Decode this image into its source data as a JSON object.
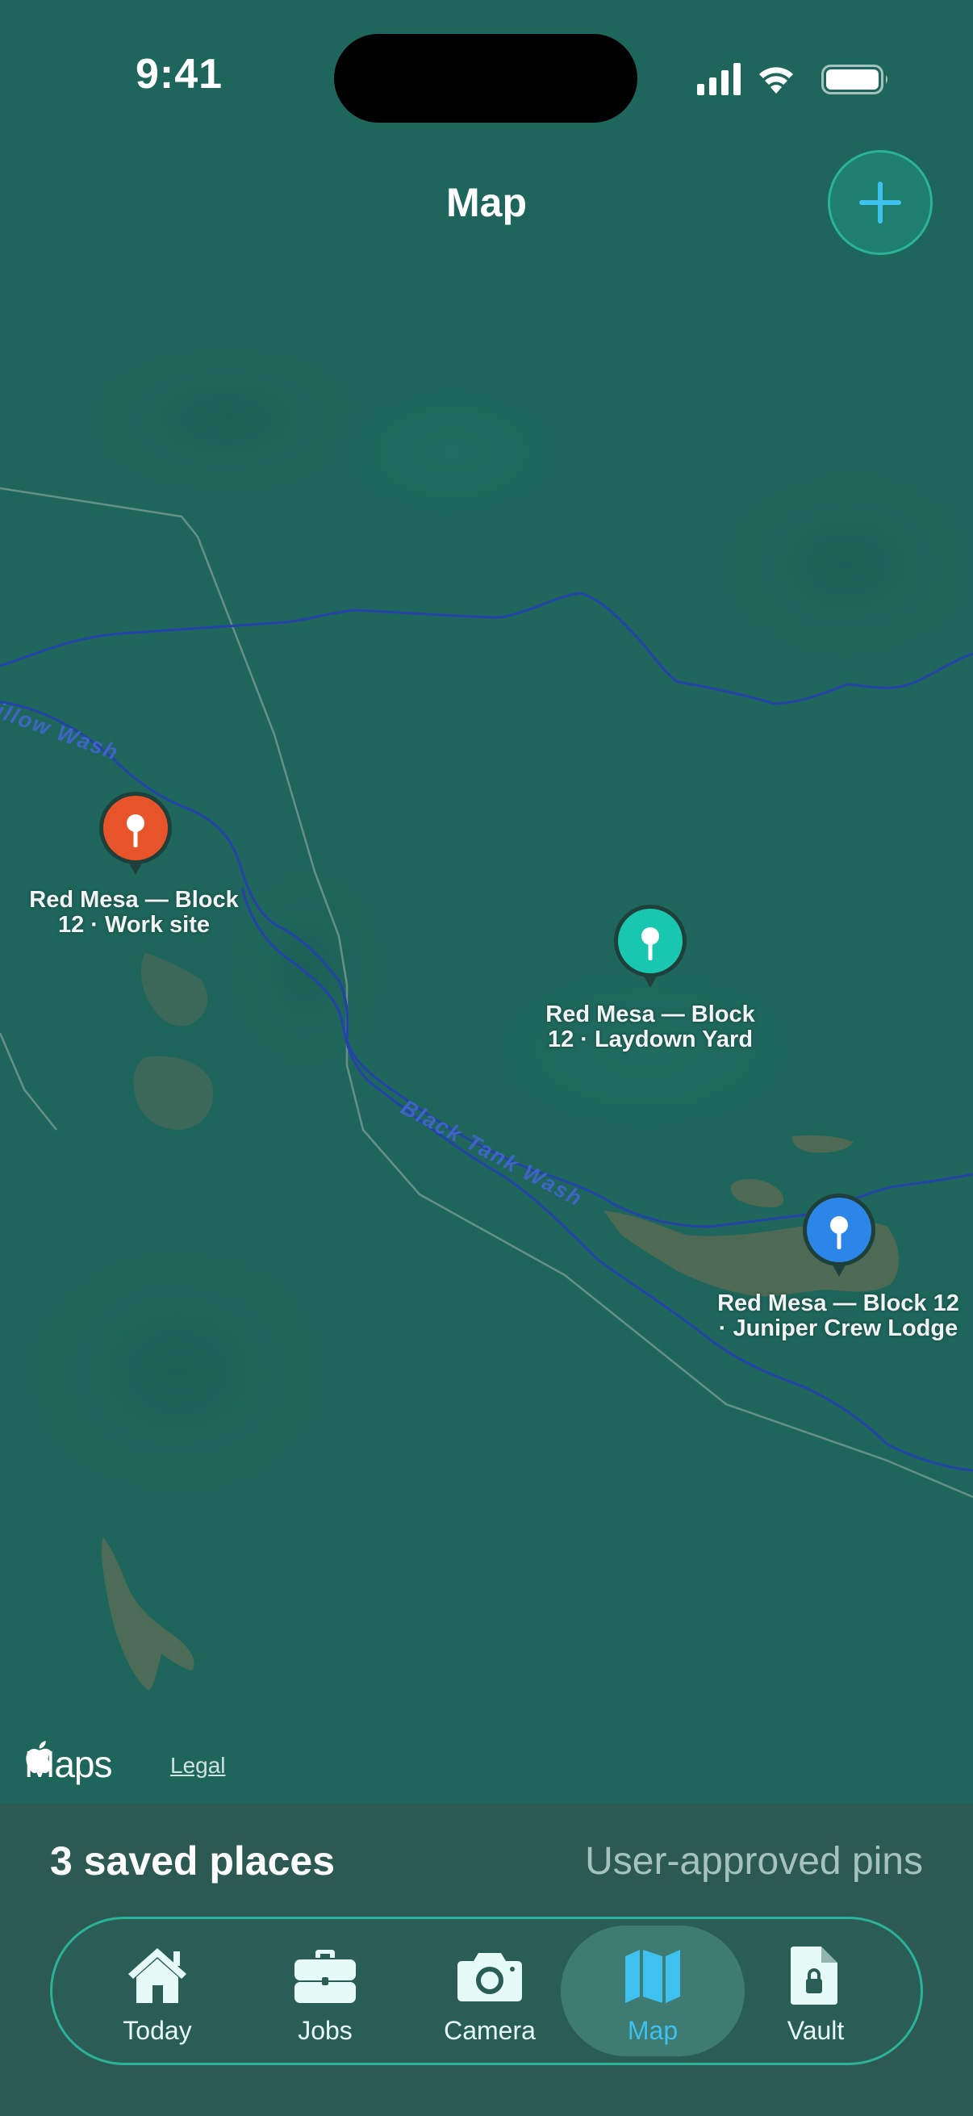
{
  "status_bar": {
    "time": "9:41"
  },
  "header": {
    "title": "Map",
    "add_icon": "plus-icon"
  },
  "map": {
    "labels": {
      "wash_1": "illow Wash",
      "wash_2": "Black Tank Wash"
    },
    "pins": [
      {
        "name": "Red Mesa — Block 12 · Work site",
        "line1": "Red Mesa — Block",
        "line2": "12 · Work site",
        "color": "#e8542a"
      },
      {
        "name": "Red Mesa — Block 12 · Laydown Yard",
        "line1": "Red Mesa — Block",
        "line2": "12 · Laydown Yard",
        "color": "#19c7b1"
      },
      {
        "name": "Red Mesa — Block 12 · Juniper Crew Lodge",
        "line1": "Red Mesa — Block 12",
        "line2": "· Juniper Crew Lodge",
        "color": "#2b86e8"
      }
    ],
    "attribution": "Maps",
    "legal": "Legal"
  },
  "bottom_sheet": {
    "count_text": "3 saved places",
    "caption": "User-approved pins"
  },
  "tab_bar": {
    "active": "Map",
    "tabs": [
      {
        "label": "Today",
        "icon": "house-icon"
      },
      {
        "label": "Jobs",
        "icon": "briefcase-icon"
      },
      {
        "label": "Camera",
        "icon": "camera-icon"
      },
      {
        "label": "Map",
        "icon": "map-icon"
      },
      {
        "label": "Vault",
        "icon": "document-lock-icon"
      }
    ]
  },
  "colors": {
    "map_background": "#1e665b",
    "water": "#2442a8",
    "accent": "#3fc1f0",
    "tab_border": "#2bb39a"
  }
}
